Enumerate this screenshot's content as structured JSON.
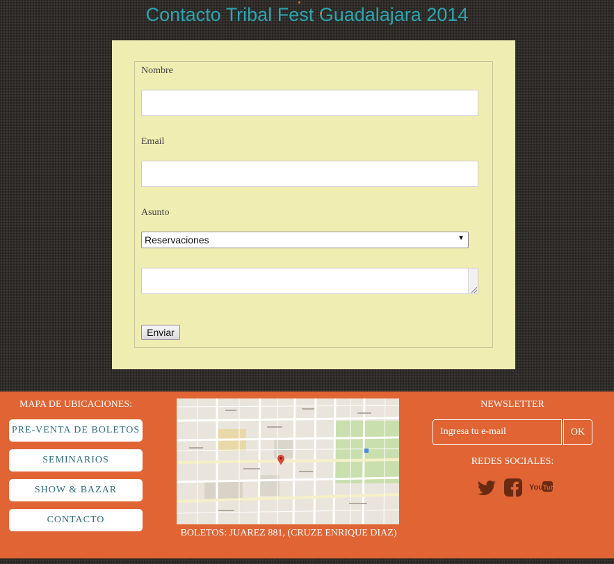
{
  "page": {
    "title": "Contacto Tribal Fest Guadalajara 2014"
  },
  "form": {
    "name_label": "Nombre",
    "email_label": "Email",
    "subject_label": "Asunto",
    "subject_selected": "Reservaciones",
    "submit_label": "Enviar"
  },
  "footer": {
    "map_heading": "MAPA DE UBICACIONES:",
    "nav_items": [
      "PRE-VENTA DE BOLETOS",
      "SEMINARIOS",
      "SHOW & BAZAR",
      "CONTACTO"
    ],
    "address": "BOLETOS: JUAREZ 881, (CRUZE ENRIQUE DIAZ)",
    "newsletter_heading": "NEWSLETTER",
    "newsletter_placeholder": "Ingresa tu e-mail",
    "ok_label": "OK",
    "social_heading": "REDES SOCIALES:",
    "social_icons": [
      "twitter-icon",
      "facebook-icon",
      "youtube-icon"
    ]
  },
  "colors": {
    "title": "#2aa6b0",
    "form_background": "#f0edb3",
    "footer_background": "#e06434",
    "nav_text": "#2e6d80",
    "social_icon": "#6a2a12"
  }
}
